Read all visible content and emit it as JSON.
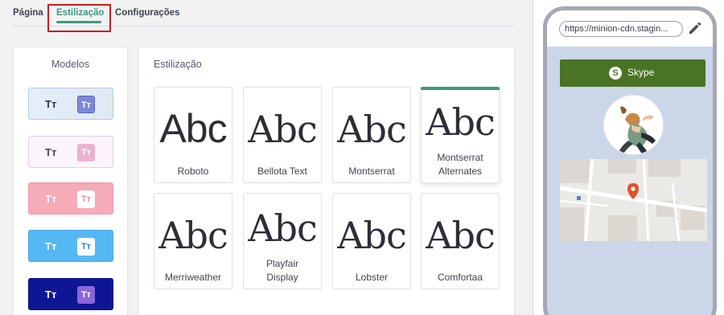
{
  "tabs": [
    {
      "label": "Página"
    },
    {
      "label": "Estilização"
    },
    {
      "label": "Configurações"
    }
  ],
  "models_panel": {
    "title": "Modelos",
    "items": [
      {
        "label_a": "Tт",
        "label_b": "Tт"
      },
      {
        "label_a": "Tт",
        "label_b": "Tт"
      },
      {
        "label_a": "Tт",
        "label_b": "Tт"
      },
      {
        "label_a": "Tт",
        "label_b": "Tт"
      },
      {
        "label_a": "Tт",
        "label_b": "Tт"
      }
    ]
  },
  "style_panel": {
    "title": "Estilização",
    "sample": "Abc",
    "fonts": [
      {
        "name_line1": "Roboto",
        "name_line2": ""
      },
      {
        "name_line1": "Bellota Text",
        "name_line2": ""
      },
      {
        "name_line1": "Montserrat",
        "name_line2": ""
      },
      {
        "name_line1": "Montserrat",
        "name_line2": "Alternates"
      },
      {
        "name_line1": "Merriweather",
        "name_line2": ""
      },
      {
        "name_line1": "Playfair",
        "name_line2": "Display"
      },
      {
        "name_line1": "Lobster",
        "name_line2": ""
      },
      {
        "name_line1": "Comfortaa",
        "name_line2": ""
      }
    ],
    "selected_font": "Montserrat Alternates"
  },
  "preview": {
    "url": "https://minion-cdn.stagin...",
    "skype_label": "Skype",
    "skype_icon_letter": "S"
  },
  "colors": {
    "accent": "#3e9b7c",
    "tab_highlight": "#c81e1e",
    "skype_button": "#4a7324",
    "phone_background": "#cbd6e8"
  }
}
